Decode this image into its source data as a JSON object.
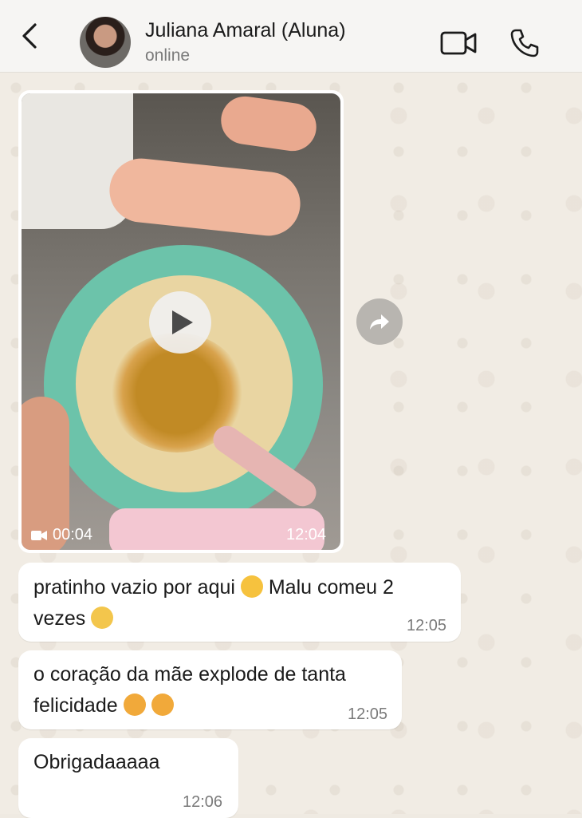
{
  "header": {
    "contact_name": "Juliana Amaral (Aluna)",
    "status": "online",
    "icons": {
      "back": "chevron-left-icon",
      "video_call": "video-camera-icon",
      "voice_call": "phone-icon"
    }
  },
  "messages": {
    "video": {
      "duration": "00:04",
      "time": "12:04",
      "icons": [
        "play-icon",
        "video-camera-icon",
        "forward-icon"
      ]
    },
    "m1": {
      "line1": "pratinho vazio por aqui",
      "line1b": "Malu comeu 2",
      "line2": "vezes",
      "time": "12:05"
    },
    "m2": {
      "line1": "o coração da mãe explode de tanta",
      "line2": "felicidade",
      "time": "12:05"
    },
    "m3": {
      "text": "Obrigadaaaaa",
      "time": "12:06"
    }
  },
  "colors": {
    "header_bg": "#f6f5f3",
    "chat_bg": "#f1ece4",
    "bubble_bg": "#ffffff",
    "meta_text": "#7a7a7a"
  }
}
